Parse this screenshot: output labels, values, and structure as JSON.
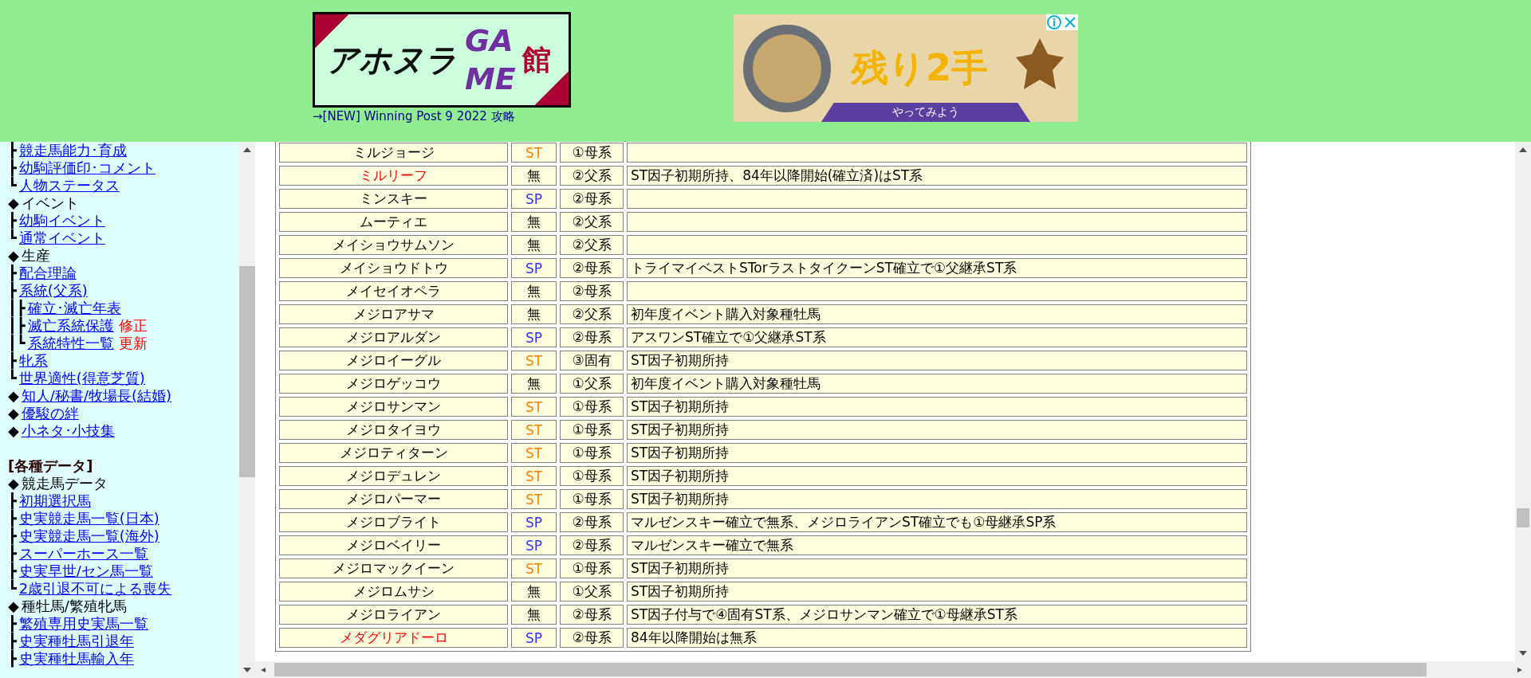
{
  "header": {
    "logo": {
      "parts": [
        "アホヌラ",
        "GA",
        "ME",
        "館"
      ]
    },
    "new_link": "→[NEW] Winning Post 9 2022 攻略",
    "ad": {
      "headline": "残り2手",
      "button": "やってみよう"
    }
  },
  "sidebar": {
    "items": [
      {
        "kind": "link",
        "prefix": "┣",
        "label": "競走馬能力･育成"
      },
      {
        "kind": "link",
        "prefix": "┣",
        "label": "幼駒評価印･コメント"
      },
      {
        "kind": "link",
        "prefix": "┗",
        "label": "人物ステータス"
      },
      {
        "kind": "heading",
        "prefix": "◆",
        "label": "イベント"
      },
      {
        "kind": "link",
        "prefix": "┣",
        "label": "幼駒イベント"
      },
      {
        "kind": "link",
        "prefix": "┗",
        "label": "通常イベント"
      },
      {
        "kind": "heading",
        "prefix": "◆",
        "label": "生産"
      },
      {
        "kind": "link",
        "prefix": "┣",
        "label": "配合理論"
      },
      {
        "kind": "link",
        "prefix": "┣",
        "label": "系統(父系)",
        "children": [
          {
            "kind": "link",
            "prefix": "┃┣",
            "label": "確立･滅亡年表"
          },
          {
            "kind": "link",
            "prefix": "┃┣",
            "label": "滅亡系統保護",
            "note": "修正"
          },
          {
            "kind": "link",
            "prefix": "┃┗",
            "label": "系統特性一覧",
            "note": "更新"
          }
        ]
      },
      {
        "kind": "link",
        "prefix": "┣",
        "label": "牝系"
      },
      {
        "kind": "link",
        "prefix": "┗",
        "label": "世界適性(得意芝質)"
      },
      {
        "kind": "link",
        "prefix": "◆",
        "label": "知人/秘書/牧場長(結婚)"
      },
      {
        "kind": "link",
        "prefix": "◆",
        "label": "優駿の絆"
      },
      {
        "kind": "link",
        "prefix": "◆",
        "label": "小ネタ･小技集"
      },
      {
        "kind": "section",
        "label": "[各種データ]"
      },
      {
        "kind": "heading",
        "prefix": "◆",
        "label": "競走馬データ"
      },
      {
        "kind": "link",
        "prefix": "┣",
        "label": "初期選択馬"
      },
      {
        "kind": "link",
        "prefix": "┣",
        "label": "史実競走馬一覧(日本)"
      },
      {
        "kind": "link",
        "prefix": "┣",
        "label": "史実競走馬一覧(海外)"
      },
      {
        "kind": "link",
        "prefix": "┣",
        "label": "スーパーホース一覧"
      },
      {
        "kind": "link",
        "prefix": "┣",
        "label": "史実早世/セン馬一覧"
      },
      {
        "kind": "link",
        "prefix": "┗",
        "label": "2歳引退不可による喪失"
      },
      {
        "kind": "heading",
        "prefix": "◆",
        "label": "種牡馬/繁殖牝馬"
      },
      {
        "kind": "link",
        "prefix": "┣",
        "label": "繁殖専用史実馬一覧"
      },
      {
        "kind": "link",
        "prefix": "┣",
        "label": "史実種牡馬引退年"
      },
      {
        "kind": "link",
        "prefix": "┣",
        "label": "史実種牡馬輸入年"
      }
    ]
  },
  "table": {
    "rows": [
      {
        "name": "ミルジョージ",
        "marked": false,
        "type": "ST",
        "color": "#ff8000",
        "line": "①母系",
        "note": ""
      },
      {
        "name": "ミルリーフ",
        "marked": true,
        "type": "無",
        "color": "#000000",
        "line": "②父系",
        "note": "ST因子初期所持、84年以降開始(確立済)はST系"
      },
      {
        "name": "ミンスキー",
        "marked": false,
        "type": "SP",
        "color": "#3333ff",
        "line": "②母系",
        "note": ""
      },
      {
        "name": "ムーティエ",
        "marked": false,
        "type": "無",
        "color": "#000000",
        "line": "②父系",
        "note": ""
      },
      {
        "name": "メイショウサムソン",
        "marked": false,
        "type": "無",
        "color": "#000000",
        "line": "②父系",
        "note": ""
      },
      {
        "name": "メイショウドトウ",
        "marked": false,
        "type": "SP",
        "color": "#3333ff",
        "line": "②母系",
        "note": "トライマイベストSTorラストタイクーンST確立で①父継承ST系"
      },
      {
        "name": "メイセイオペラ",
        "marked": false,
        "type": "無",
        "color": "#000000",
        "line": "②母系",
        "note": ""
      },
      {
        "name": "メジロアサマ",
        "marked": false,
        "type": "無",
        "color": "#000000",
        "line": "②父系",
        "note": "初年度イベント購入対象種牡馬"
      },
      {
        "name": "メジロアルダン",
        "marked": false,
        "type": "SP",
        "color": "#3333ff",
        "line": "②母系",
        "note": "アスワンST確立で①父継承ST系"
      },
      {
        "name": "メジロイーグル",
        "marked": false,
        "type": "ST",
        "color": "#ff8000",
        "line": "③固有",
        "note": "ST因子初期所持"
      },
      {
        "name": "メジロゲッコウ",
        "marked": false,
        "type": "無",
        "color": "#000000",
        "line": "①父系",
        "note": "初年度イベント購入対象種牡馬"
      },
      {
        "name": "メジロサンマン",
        "marked": false,
        "type": "ST",
        "color": "#ff8000",
        "line": "①母系",
        "note": "ST因子初期所持"
      },
      {
        "name": "メジロタイヨウ",
        "marked": false,
        "type": "ST",
        "color": "#ff8000",
        "line": "①母系",
        "note": "ST因子初期所持"
      },
      {
        "name": "メジロティターン",
        "marked": false,
        "type": "ST",
        "color": "#ff8000",
        "line": "①母系",
        "note": "ST因子初期所持"
      },
      {
        "name": "メジロデュレン",
        "marked": false,
        "type": "ST",
        "color": "#ff8000",
        "line": "①母系",
        "note": "ST因子初期所持"
      },
      {
        "name": "メジロパーマー",
        "marked": false,
        "type": "ST",
        "color": "#ff8000",
        "line": "①母系",
        "note": "ST因子初期所持"
      },
      {
        "name": "メジロブライト",
        "marked": false,
        "type": "SP",
        "color": "#3333ff",
        "line": "②母系",
        "note": "マルゼンスキー確立で無系、メジロライアンST確立でも①母継承SP系"
      },
      {
        "name": "メジロベイリー",
        "marked": false,
        "type": "SP",
        "color": "#3333ff",
        "line": "②母系",
        "note": "マルゼンスキー確立で無系"
      },
      {
        "name": "メジロマックイーン",
        "marked": false,
        "type": "ST",
        "color": "#ff8000",
        "line": "①母系",
        "note": "ST因子初期所持"
      },
      {
        "name": "メジロムサシ",
        "marked": false,
        "type": "無",
        "color": "#000000",
        "line": "①父系",
        "note": "ST因子初期所持"
      },
      {
        "name": "メジロライアン",
        "marked": false,
        "type": "無",
        "color": "#000000",
        "line": "②母系",
        "note": "ST因子付与で④固有ST系、メジロサンマン確立で①母継承ST系"
      },
      {
        "name": "メダグリアドーロ",
        "marked": true,
        "type": "SP",
        "color": "#3333ff",
        "line": "②母系",
        "note": "84年以降開始は無系"
      }
    ]
  }
}
